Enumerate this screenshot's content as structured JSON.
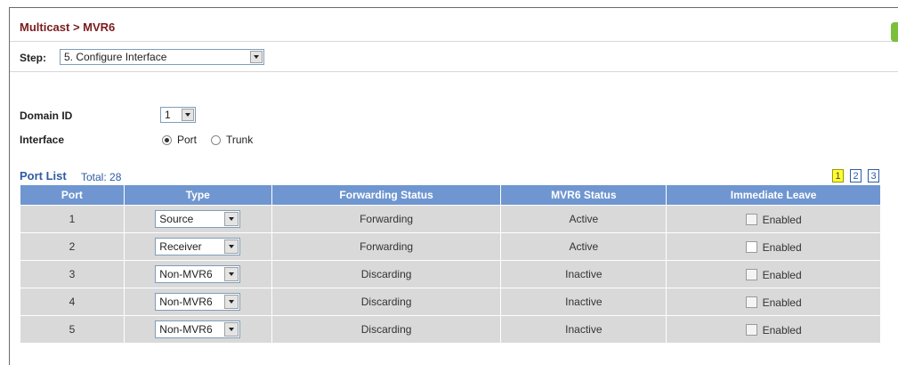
{
  "header": {
    "title": "Multicast > MVR6"
  },
  "step": {
    "label": "Step:",
    "selected": "5. Configure Interface"
  },
  "form": {
    "domain_label": "Domain ID",
    "domain_value": "1",
    "interface_label": "Interface",
    "interface_options": [
      {
        "label": "Port",
        "selected": true
      },
      {
        "label": "Trunk",
        "selected": false
      }
    ]
  },
  "port_list": {
    "title": "Port List",
    "total": "Total: 28",
    "pages": [
      "1",
      "2",
      "3"
    ],
    "current_page": "1"
  },
  "table": {
    "headers": [
      "Port",
      "Type",
      "Forwarding Status",
      "MVR6 Status",
      "Immediate Leave"
    ],
    "rows": [
      {
        "port": "1",
        "type": "Source",
        "forwarding": "Forwarding",
        "status": "Active",
        "leave": "Enabled"
      },
      {
        "port": "2",
        "type": "Receiver",
        "forwarding": "Forwarding",
        "status": "Active",
        "leave": "Enabled"
      },
      {
        "port": "3",
        "type": "Non-MVR6",
        "forwarding": "Discarding",
        "status": "Inactive",
        "leave": "Enabled"
      },
      {
        "port": "4",
        "type": "Non-MVR6",
        "forwarding": "Discarding",
        "status": "Inactive",
        "leave": "Enabled"
      },
      {
        "port": "5",
        "type": "Non-MVR6",
        "forwarding": "Discarding",
        "status": "Inactive",
        "leave": "Enabled"
      }
    ]
  },
  "colors": {
    "title": "#7a1c1c",
    "accent_blue": "#2d5ba5",
    "header_bg": "#6f96d0",
    "row_bg": "#d9d9d9",
    "current_page_bg": "#ffff33"
  }
}
